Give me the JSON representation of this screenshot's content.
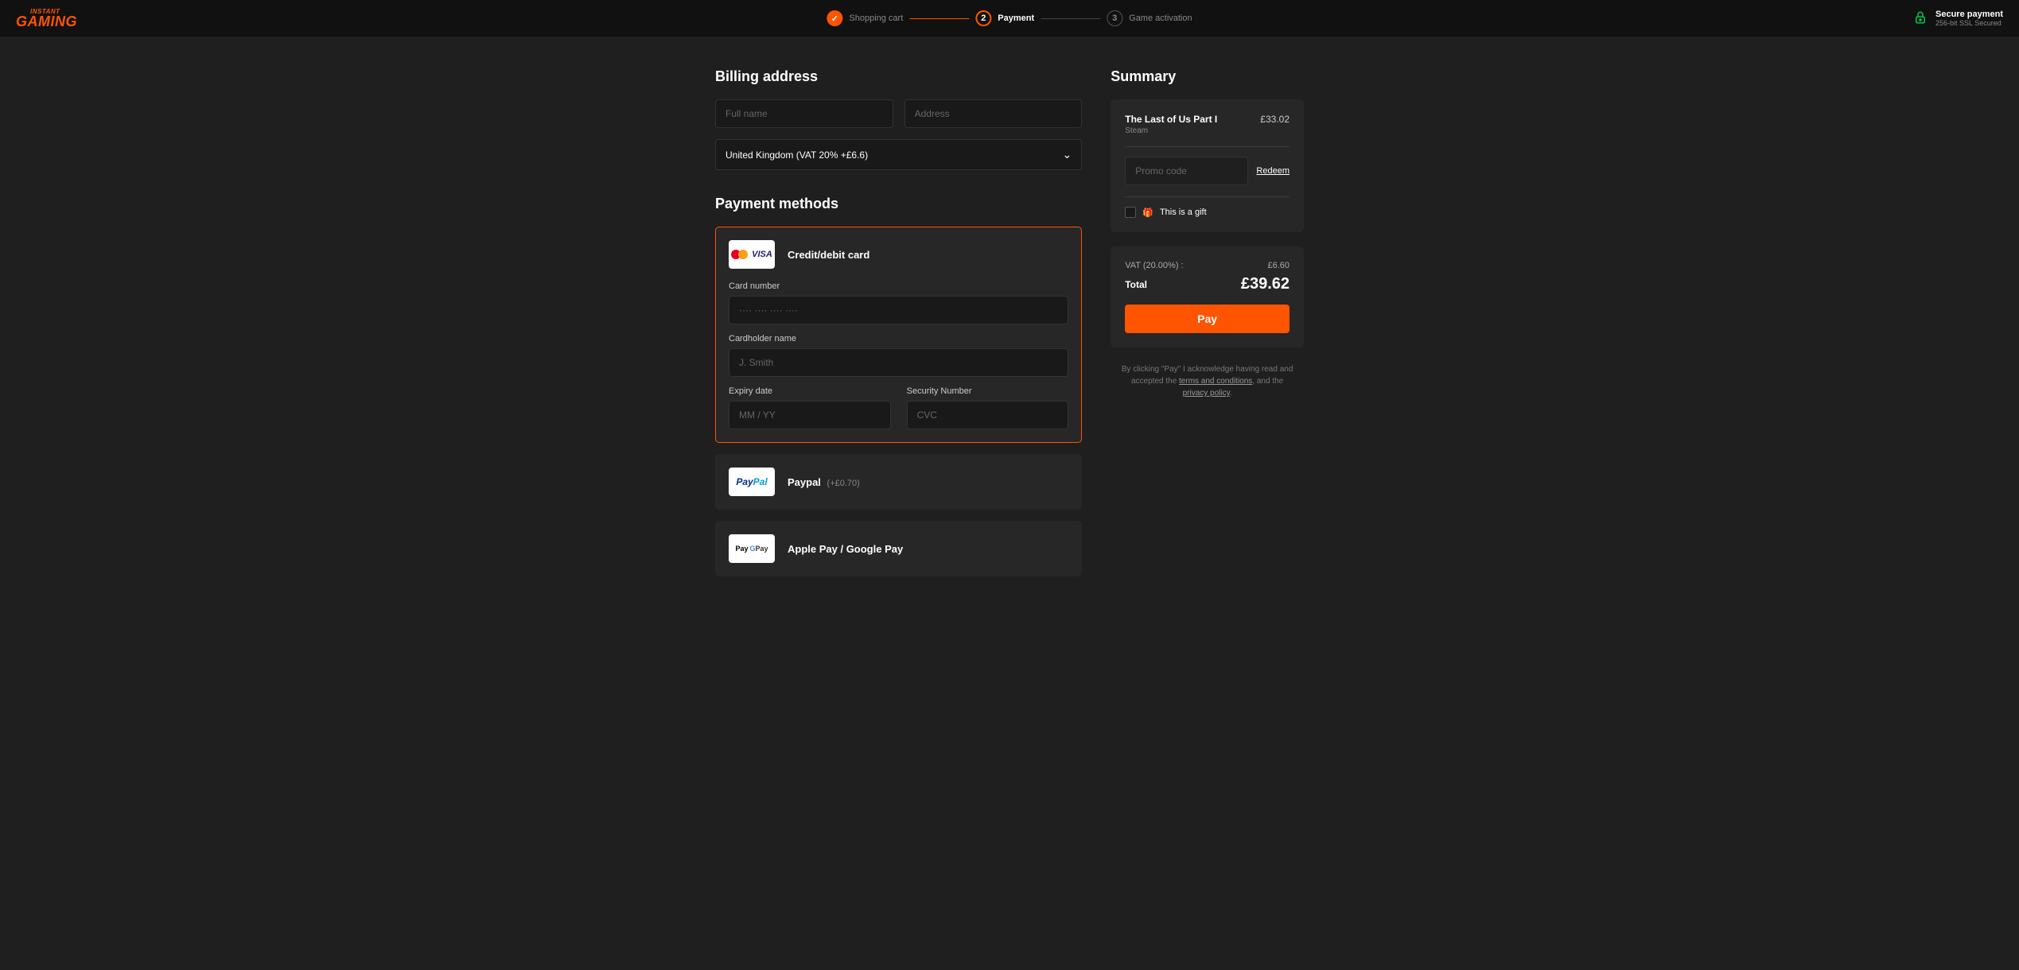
{
  "brand": {
    "top": "INSTANT",
    "bottom": "GAMING"
  },
  "stepper": {
    "step1": {
      "label": "Shopping cart"
    },
    "step2": {
      "num": "2",
      "label": "Payment"
    },
    "step3": {
      "num": "3",
      "label": "Game activation"
    }
  },
  "secure": {
    "title": "Secure payment",
    "sub": "256-bit SSL Secured"
  },
  "billing": {
    "heading": "Billing address",
    "full_name_ph": "Full name",
    "address_ph": "Address",
    "country": "United Kingdom (VAT 20% +£6.6)"
  },
  "payment": {
    "heading": "Payment methods",
    "card": {
      "title": "Credit/debit card",
      "num_label": "Card number",
      "num_ph": "···· ···· ···· ····",
      "holder_label": "Cardholder name",
      "holder_ph": "J. Smith",
      "expiry_label": "Expiry date",
      "expiry_ph": "MM / YY",
      "cvc_label": "Security Number",
      "cvc_ph": "CVC"
    },
    "paypal": {
      "title": "Paypal",
      "extra": "(+£0.70)"
    },
    "wallet": {
      "title": "Apple Pay / Google Pay"
    }
  },
  "summary": {
    "heading": "Summary",
    "product": {
      "name": "The Last of Us Part I",
      "platform": "Steam",
      "price": "£33.02"
    },
    "promo_ph": "Promo code",
    "redeem": "Redeem",
    "gift_label": "This is a gift",
    "vat_label": "VAT (20.00%) :",
    "vat_value": "£6.60",
    "total_label": "Total",
    "total_value": "£39.62",
    "pay_btn": "Pay"
  },
  "legal": {
    "pre": "By clicking \"Pay\" I acknowledge having read and accepted the ",
    "terms": "terms and conditions",
    "mid": ", and the ",
    "privacy": "privacy policy",
    "post": "."
  }
}
